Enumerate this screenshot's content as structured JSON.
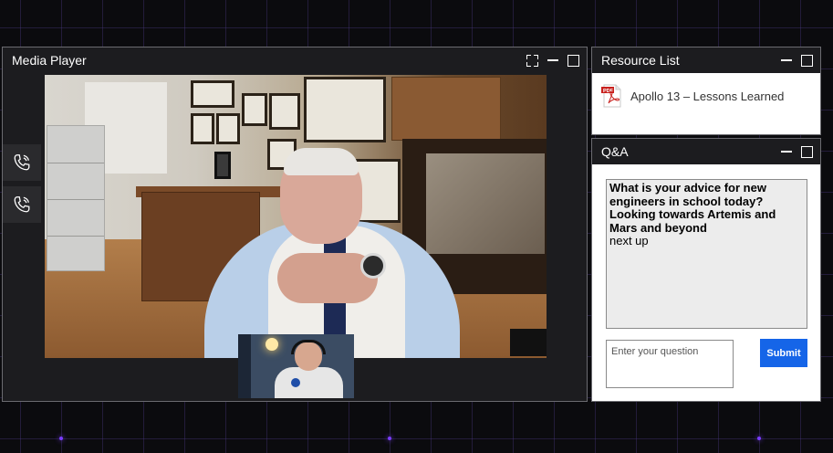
{
  "media_player": {
    "title": "Media Player",
    "controls": [
      "fullscreen-icon",
      "minimize-icon",
      "maximize-icon"
    ],
    "side_buttons": [
      "phone-call-icon",
      "phone-call-icon"
    ]
  },
  "resource_list": {
    "title": "Resource List",
    "items": [
      {
        "icon": "pdf-icon",
        "label": "Apollo 13 – Lessons Learned"
      }
    ]
  },
  "qa": {
    "title": "Q&A",
    "question": "What is your advice for new engineers in school today? Looking towards Artemis and Mars and beyond",
    "status": "next up",
    "input_placeholder": "Enter your question",
    "submit_label": "Submit"
  },
  "colors": {
    "background": "#0b0b0e",
    "window": "#1c1c1f",
    "accent_grid_dot": "#7a3cff",
    "submit": "#1565e8"
  }
}
